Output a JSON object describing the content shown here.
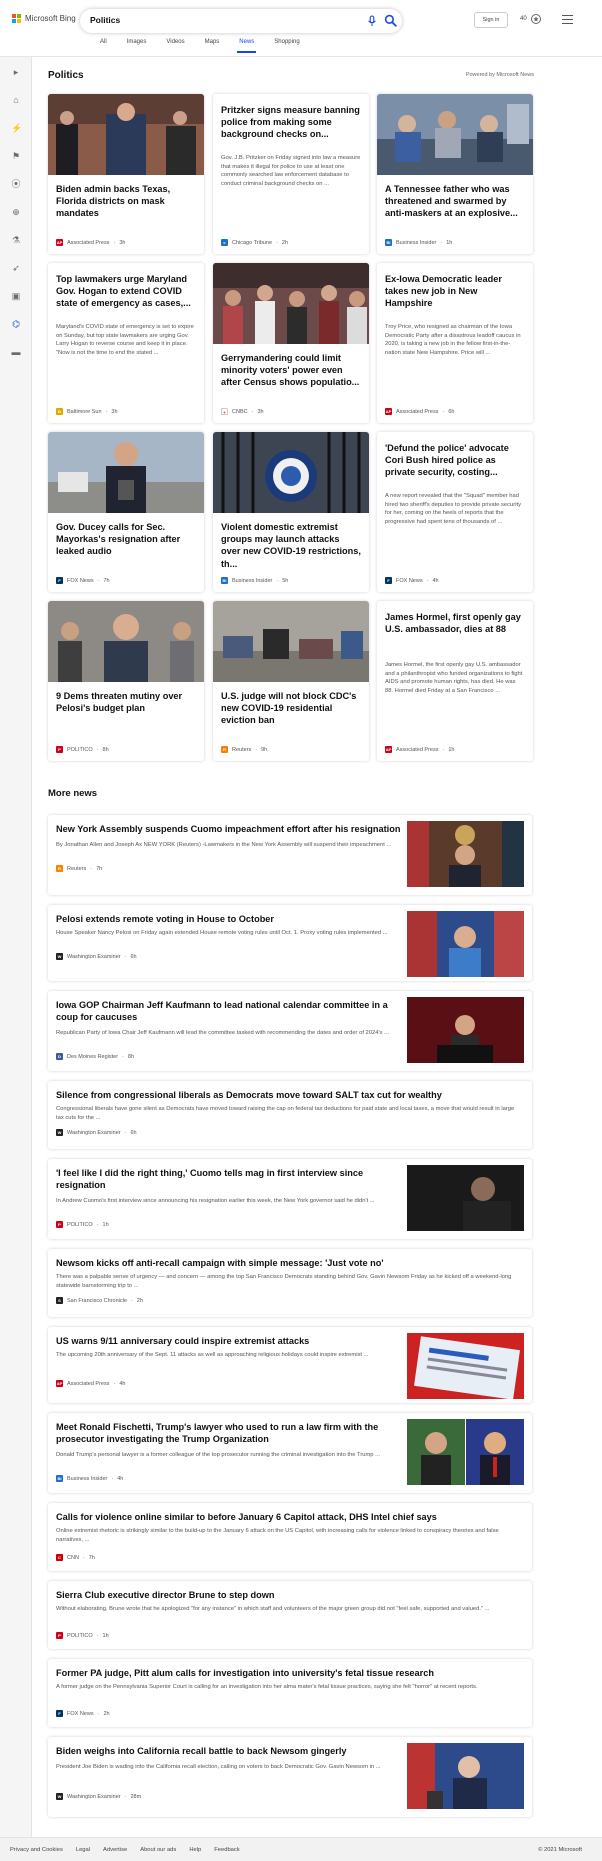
{
  "header": {
    "logo_text": "Microsoft Bing",
    "query": "Politics",
    "signin_label": "Sign in",
    "rewards_count": "40",
    "tabs": [
      {
        "label": "All"
      },
      {
        "label": "Images"
      },
      {
        "label": "Videos"
      },
      {
        "label": "Maps"
      },
      {
        "label": "News",
        "active": true
      },
      {
        "label": "Shopping"
      }
    ]
  },
  "section": {
    "title": "Politics",
    "powered": "Powered by Microsoft News"
  },
  "cards": [
    {
      "title": "Biden admin backs Texas, Florida districts on mask mandates",
      "source": "Associated Press",
      "time": "3h",
      "has_image": true
    },
    {
      "title": "Pritzker signs measure banning police from making some background checks on...",
      "snippet": "Gov. J.B. Pritzker on Friday signed into law a measure that makes it illegal for police to use at least one commonly searched law enforcement database to conduct criminal background checks on ...",
      "source": "Chicago Tribune",
      "time": "2h",
      "has_image": false
    },
    {
      "title": "A Tennessee father who was threatened and swarmed by anti-maskers at an explosive...",
      "source": "Business Insider",
      "time": "1h",
      "has_image": true
    },
    {
      "title": "Top lawmakers urge Maryland Gov. Hogan to extend COVID state of emergency as cases,...",
      "snippet": "Maryland's COVID state of emergency is set to expire on Sunday, but top state lawmakers are urging Gov. Larry Hogan to reverse course and keep it in place. \"Now is not the time to end the stated ...",
      "source": "Baltimore Sun",
      "time": "3h",
      "has_image": false
    },
    {
      "title": "Gerrymandering could limit minority voters' power even after Census shows populatio...",
      "source": "CNBC",
      "time": "3h",
      "has_image": true
    },
    {
      "title": "Ex-Iowa Democratic leader takes new job in New Hampshire",
      "snippet": "Troy Price, who resigned as chairman of the Iowa Democratic Party after a disastrous leadoff caucus in 2020, is taking a new job in the fellow first-in-the-nation state New Hampshire. Price will ...",
      "source": "Associated Press",
      "time": "6h",
      "has_image": false
    },
    {
      "title": "Gov. Ducey calls for Sec. Mayorkas's resignation after leaked audio",
      "source": "FOX News",
      "time": "7h",
      "has_image": true
    },
    {
      "title": "Violent domestic extremist groups may launch attacks over new COVID-19 restrictions, th...",
      "source": "Business Insider",
      "time": "5h",
      "has_image": true
    },
    {
      "title": "'Defund the police' advocate Cori Bush hired police as private security, costing...",
      "snippet": "A new report revealed that the \"Squad\" member had hired two sheriff's deputies to provide private security for her, coming on the heels of reports that the progressive had spent tens of thousands of ...",
      "source": "FOX News",
      "time": "4h",
      "has_image": false
    },
    {
      "title": "9 Dems threaten mutiny over Pelosi's budget plan",
      "source": "POLITICO",
      "time": "8h",
      "has_image": true
    },
    {
      "title": "U.S. judge will not block CDC's new COVID-19 residential eviction ban",
      "source": "Reuters",
      "time": "9h",
      "has_image": true
    },
    {
      "title": "James Hormel, first openly gay U.S. ambassador, dies at 88",
      "snippet": "James Hormel, the first openly gay U.S. ambassador and a philanthropist who funded organizations to fight AIDS and promote human rights, has died. He was 88. Hormel died Friday at a San Francisco ...",
      "source": "Associated Press",
      "time": "1h",
      "has_image": false
    }
  ],
  "more_news": {
    "title": "More news",
    "items": [
      {
        "title": "New York Assembly suspends Cuomo impeachment effort after his resignation",
        "snippet": "By Jonathan Allen and Joseph Ax NEW YORK (Reuters) -Lawmakers in the New York Assembly will suspend their impeachment ...",
        "source": "Reuters",
        "time": "7h",
        "has_image": true
      },
      {
        "title": "Pelosi extends remote voting in House to October",
        "snippet": "House Speaker Nancy Pelosi on Friday again extended House remote voting rules until Oct. 1. Proxy voting rules implemented ...",
        "source": "Washington Examiner",
        "time": "6h",
        "has_image": true
      },
      {
        "title": "Iowa GOP Chairman Jeff Kaufmann to lead national calendar committee in a coup for caucuses",
        "snippet": "Republican Party of Iowa Chair Jeff Kaufmann will lead the committee tasked with recommending the dates and order of 2024's ...",
        "source": "Des Moines Register",
        "time": "8h",
        "has_image": true
      },
      {
        "title": "Silence from congressional liberals as Democrats move toward SALT tax cut for wealthy",
        "snippet": "Congressional liberals have gone silent as Democrats have moved toward raising the cap on federal tax deductions for paid state and local taxes, a move that would result in large tax cuts for the ...",
        "source": "Washington Examiner",
        "time": "6h",
        "has_image": false
      },
      {
        "title": "'I feel like I did the right thing,' Cuomo tells mag in first interview since resignation",
        "snippet": "In Andrew Cuomo's first interview since announcing his resignation earlier this week, the New York governor said he didn't ...",
        "source": "POLITICO",
        "time": "1h",
        "has_image": true
      },
      {
        "title": "Newsom kicks off anti-recall campaign with simple message: 'Just vote no'",
        "snippet": "There was a palpable sense of urgency — and concern — among the top San Francisco Democrats standing behind Gov. Gavin Newsom Friday as he kicked off a weekend-long statewide barnstorming trip to ...",
        "source": "San Francisco Chronicle",
        "time": "2h",
        "has_image": false
      },
      {
        "title": "US warns 9/11 anniversary could inspire extremist attacks",
        "snippet": "The upcoming 20th anniversary of the Sept. 11 attacks as well as approaching religious holidays could inspire extremist ...",
        "source": "Associated Press",
        "time": "4h",
        "has_image": true
      },
      {
        "title": "Meet Ronald Fischetti, Trump's lawyer who used to run a law firm with the prosecutor investigating the Trump Organization",
        "snippet": "Donald Trump's personal lawyer is a former colleague of the top prosecutor running the criminal investigation into the Trump ...",
        "source": "Business Insider",
        "time": "4h",
        "has_image": true
      },
      {
        "title": "Calls for violence online similar to before January 6 Capitol attack, DHS Intel chief says",
        "snippet": "Online extremist rhetoric is strikingly similar to the build-up to the January 6 attack on the US Capitol, with increasing calls for violence linked to conspiracy theories and false narratives, ...",
        "source": "CNN",
        "time": "7h",
        "has_image": false
      },
      {
        "title": "Sierra Club executive director Brune to step down",
        "snippet": "Without elaborating, Brune wrote that he apologized \"for any instance\" in which staff and volunteers of the major green group did not \"feel safe, supported and valued.\" ...",
        "source": "POLITICO",
        "time": "1h",
        "has_image": false
      },
      {
        "title": "Former PA judge, Pitt alum calls for investigation into university's fetal tissue research",
        "snippet": "A former judge on the Pennsylvania Superior Court is calling for an investigation into her alma mater's fetal tissue practices, saying she felt \"horror\" at recent reports.",
        "source": "FOX News",
        "time": "2h",
        "has_image": false
      },
      {
        "title": "Biden weighs into California recall battle to back Newsom gingerly",
        "snippet": "President Joe Biden is wading into the California recall election, calling on voters to back Democratic Gov. Gavin Newsom in ...",
        "source": "Washington Examiner",
        "time": "28m",
        "has_image": true
      }
    ]
  },
  "footer": {
    "links": [
      "Privacy and Cookies",
      "Legal",
      "Advertise",
      "About our ads",
      "Help",
      "Feedback"
    ],
    "copyright": "© 2021 Microsoft"
  },
  "icons": {
    "logo": "bing-logo",
    "mic": "microphone-icon",
    "search": "search-icon",
    "rewards": "rewards-icon",
    "menu": "hamburger-menu-icon"
  },
  "colors": {
    "accent": "#174ae4",
    "rail": "#f5f5f5"
  }
}
